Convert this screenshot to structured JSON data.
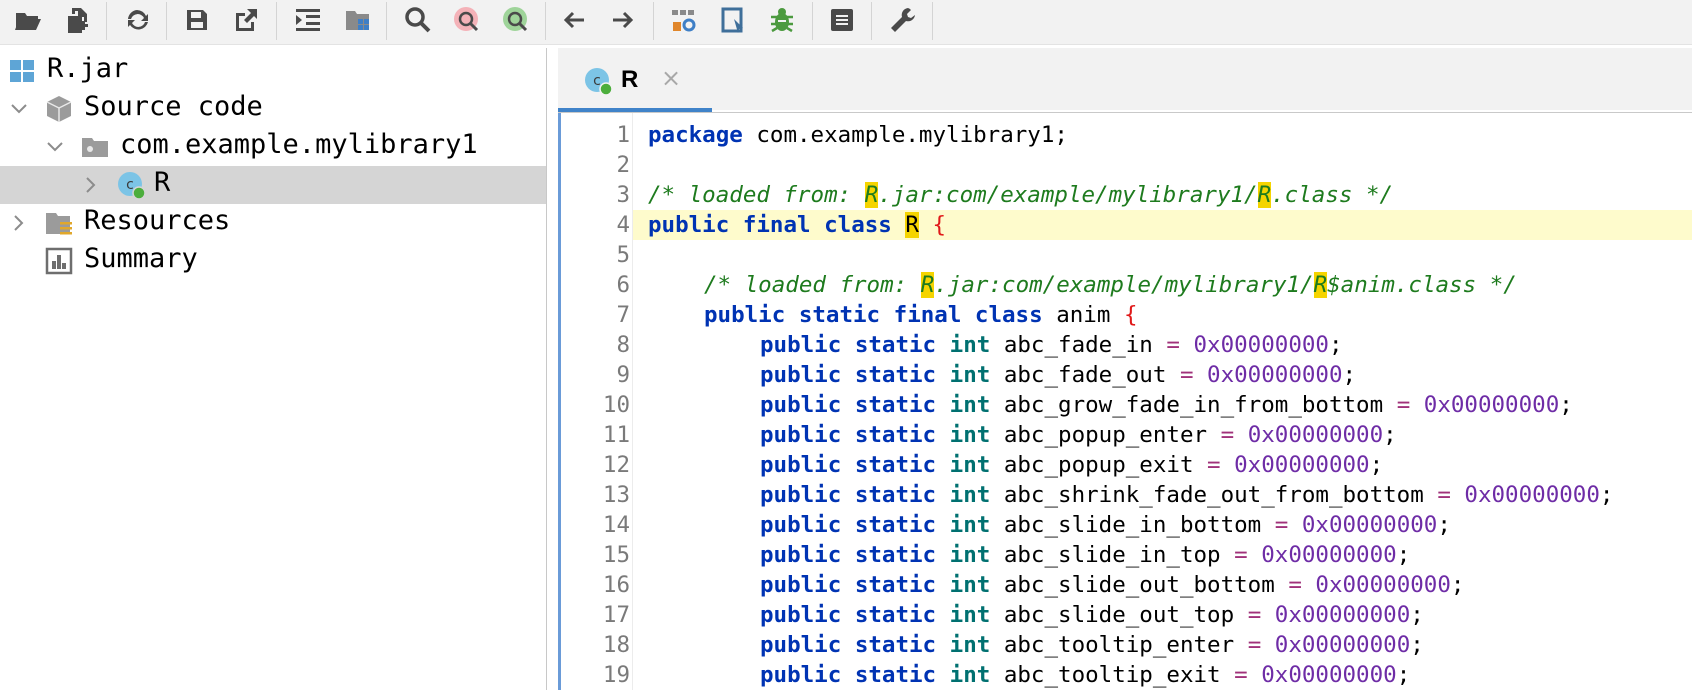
{
  "toolbar": {
    "buttons": [
      {
        "name": "open-folder-icon"
      },
      {
        "name": "new-file-icon"
      },
      {
        "name": "refresh-icon"
      },
      {
        "name": "save-icon"
      },
      {
        "name": "export-icon"
      },
      {
        "name": "collapse-icon"
      },
      {
        "name": "project-structure-icon"
      },
      {
        "name": "search-icon"
      },
      {
        "name": "find-usages-icon"
      },
      {
        "name": "search-everywhere-icon"
      },
      {
        "name": "back-icon"
      },
      {
        "name": "forward-icon"
      },
      {
        "name": "settings-network-icon"
      },
      {
        "name": "bookmark-icon"
      },
      {
        "name": "bug-icon"
      },
      {
        "name": "structure-icon"
      },
      {
        "name": "wrench-icon"
      }
    ]
  },
  "tree": {
    "root": "R.jar",
    "source_code": "Source code",
    "package": "com.example.mylibrary1",
    "class": "R",
    "resources": "Resources",
    "summary": "Summary"
  },
  "tabs": [
    {
      "label": "R",
      "close": "×"
    }
  ],
  "editor": {
    "highlighted_line": 4,
    "lines": [
      {
        "n": "1"
      },
      {
        "n": "2"
      },
      {
        "n": "3"
      },
      {
        "n": "4"
      },
      {
        "n": "5"
      },
      {
        "n": "6"
      },
      {
        "n": "7"
      },
      {
        "n": "8"
      },
      {
        "n": "9"
      },
      {
        "n": "10"
      },
      {
        "n": "11"
      },
      {
        "n": "12"
      },
      {
        "n": "13"
      },
      {
        "n": "14"
      },
      {
        "n": "15"
      },
      {
        "n": "16"
      },
      {
        "n": "17"
      },
      {
        "n": "18"
      },
      {
        "n": "19"
      }
    ],
    "code": {
      "l1_kw": "package",
      "l1_rest": " com.example.mylibrary1;",
      "l3_a": "/* loaded from: ",
      "l3_r1": "R",
      "l3_b": ".jar:com/example/mylibrary1/",
      "l3_r2": "R",
      "l3_c": ".class */",
      "l4_kw": "public final class",
      "l4_sp": " ",
      "l4_name": "R",
      "l4_br": " {",
      "l6_a": "/* loaded from: ",
      "l6_r1": "R",
      "l6_b": ".jar:com/example/mylibrary1/",
      "l6_r2": "R",
      "l6_c": "$anim.class */",
      "l7_kw": "public static final class",
      "l7_name": " anim ",
      "l7_br": "{",
      "field_mod": "public static",
      "field_type": "int",
      "eq": "=",
      "value": "0x00000000",
      "semi": ";",
      "fields": [
        "abc_fade_in",
        "abc_fade_out",
        "abc_grow_fade_in_from_bottom",
        "abc_popup_enter",
        "abc_popup_exit",
        "abc_shrink_fade_out_from_bottom",
        "abc_slide_in_bottom",
        "abc_slide_in_top",
        "abc_slide_out_bottom",
        "abc_slide_out_top",
        "abc_tooltip_enter",
        "abc_tooltip_exit"
      ]
    }
  },
  "colors": {
    "keyword": "#0033b3",
    "type": "#007070",
    "comment": "#1e7b1e",
    "search_mark": "#f5d400",
    "brace": "#e01919",
    "number": "#6e2ca6",
    "line_highlight": "#fefbcc",
    "selection": "#d5d5d5"
  }
}
